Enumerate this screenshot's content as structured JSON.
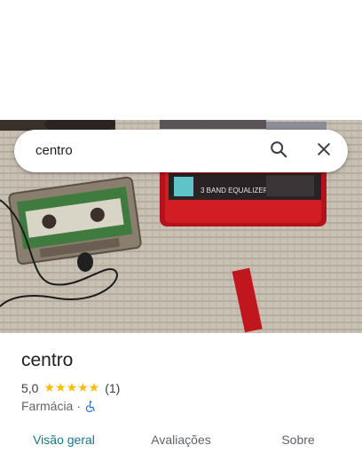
{
  "search": {
    "query": "centro"
  },
  "place": {
    "name": "centro",
    "rating": "5,0",
    "stars": "★★★★★",
    "review_count": "(1)",
    "category": "Farmácia",
    "separator": "·"
  },
  "tabs": [
    {
      "label": "Visão geral",
      "active": true
    },
    {
      "label": "Avaliações",
      "active": false
    },
    {
      "label": "Sobre",
      "active": false
    }
  ],
  "photo": {
    "lcd_text": "3 BAND EQUALIZER"
  },
  "colors": {
    "accent": "#137a89",
    "star": "#fbbc04",
    "accessibility": "#1a73e8"
  }
}
